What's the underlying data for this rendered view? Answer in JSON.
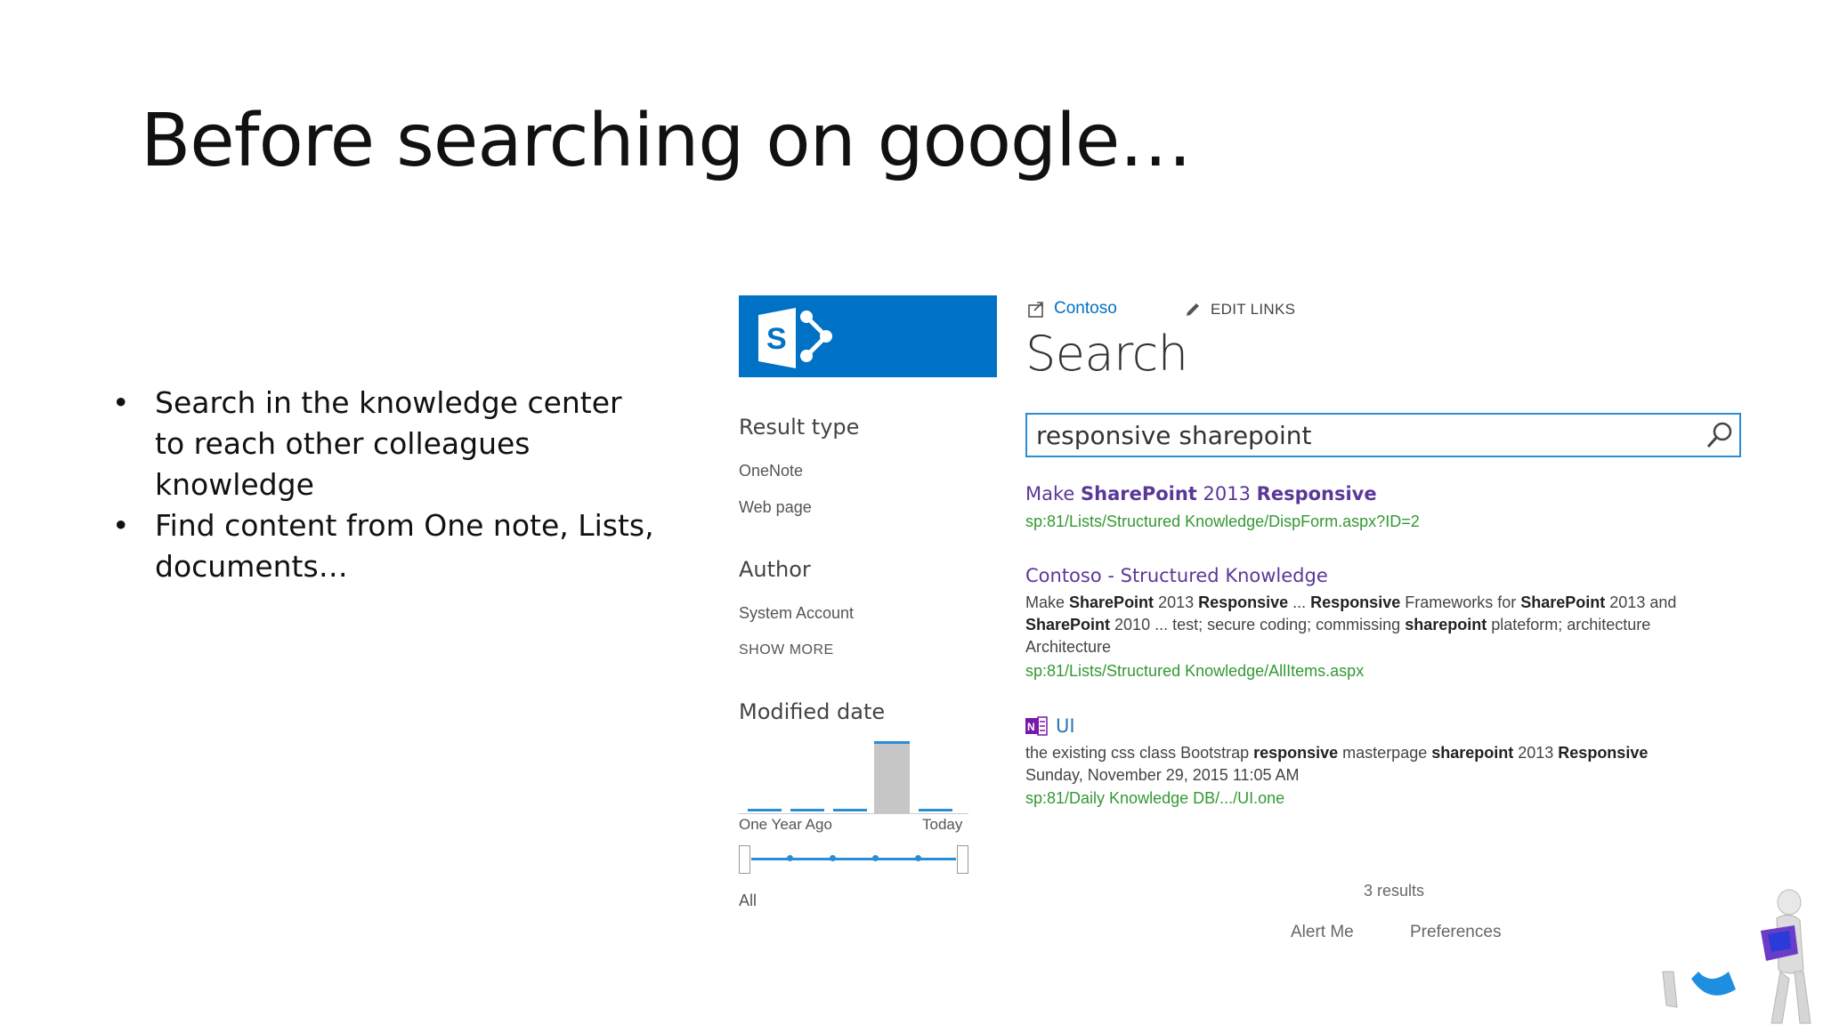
{
  "slide": {
    "title": "Before searching on google…",
    "bullets": [
      "Search in the knowledge center to reach other colleagues knowledge",
      "Find content from One note, Lists, documents…"
    ]
  },
  "sharepoint": {
    "site_link": "Contoso",
    "edit_links": "EDIT LINKS",
    "page_heading": "Search",
    "search_query": "responsive sharepoint",
    "refiners": {
      "result_type": {
        "heading": "Result type",
        "items": [
          "OneNote",
          "Web page"
        ]
      },
      "author": {
        "heading": "Author",
        "items": [
          "System Account"
        ],
        "more": "SHOW MORE"
      },
      "modified_date": {
        "heading": "Modified date",
        "axis_start": "One Year Ago",
        "axis_end": "Today",
        "selection": "All",
        "bucket_levels": [
          0,
          0,
          0,
          1,
          0
        ]
      }
    },
    "results": [
      {
        "title_pre": "Make ",
        "title_b1": "SharePoint",
        "title_mid": " 2013 ",
        "title_b2": "Responsive",
        "url": "sp:81/Lists/Structured Knowledge/DispForm.aspx?ID=2"
      },
      {
        "title": "Contoso - Structured Knowledge",
        "summary": {
          "s1": "Make ",
          "b1": "SharePoint",
          "s2": " 2013 ",
          "b2": "Responsive",
          "s3": " ... ",
          "b3": "Responsive",
          "s4": " Frameworks for ",
          "b4": "SharePoint",
          "s5": " 2013 and ",
          "b5": "SharePoint",
          "s6": " 2010 ... test; secure coding; commissing ",
          "b6": "sharepoint",
          "s7": " plateform; architecture Architecture"
        },
        "url": "sp:81/Lists/Structured Knowledge/AllItems.aspx"
      },
      {
        "title": "UI",
        "summary": {
          "s1": "the existing css class Bootstrap ",
          "b1": "responsive",
          "s2": " masterpage ",
          "b2": "sharepoint",
          "s3": " 2013 ",
          "b3": "Responsive"
        },
        "date": "Sunday, November 29, 2015 11:05 AM",
        "url": "sp:81/Daily Knowledge DB/.../UI.one"
      }
    ],
    "result_count": "3 results",
    "footer_links": [
      "Alert Me",
      "Preferences"
    ]
  },
  "colors": {
    "sharepoint_blue": "#0072c6",
    "visited_link": "#5a3897",
    "url_green": "#339933"
  },
  "icons": [
    "sharepoint-logo-icon",
    "share-icon",
    "pencil-icon",
    "search-icon",
    "onenote-icon"
  ]
}
